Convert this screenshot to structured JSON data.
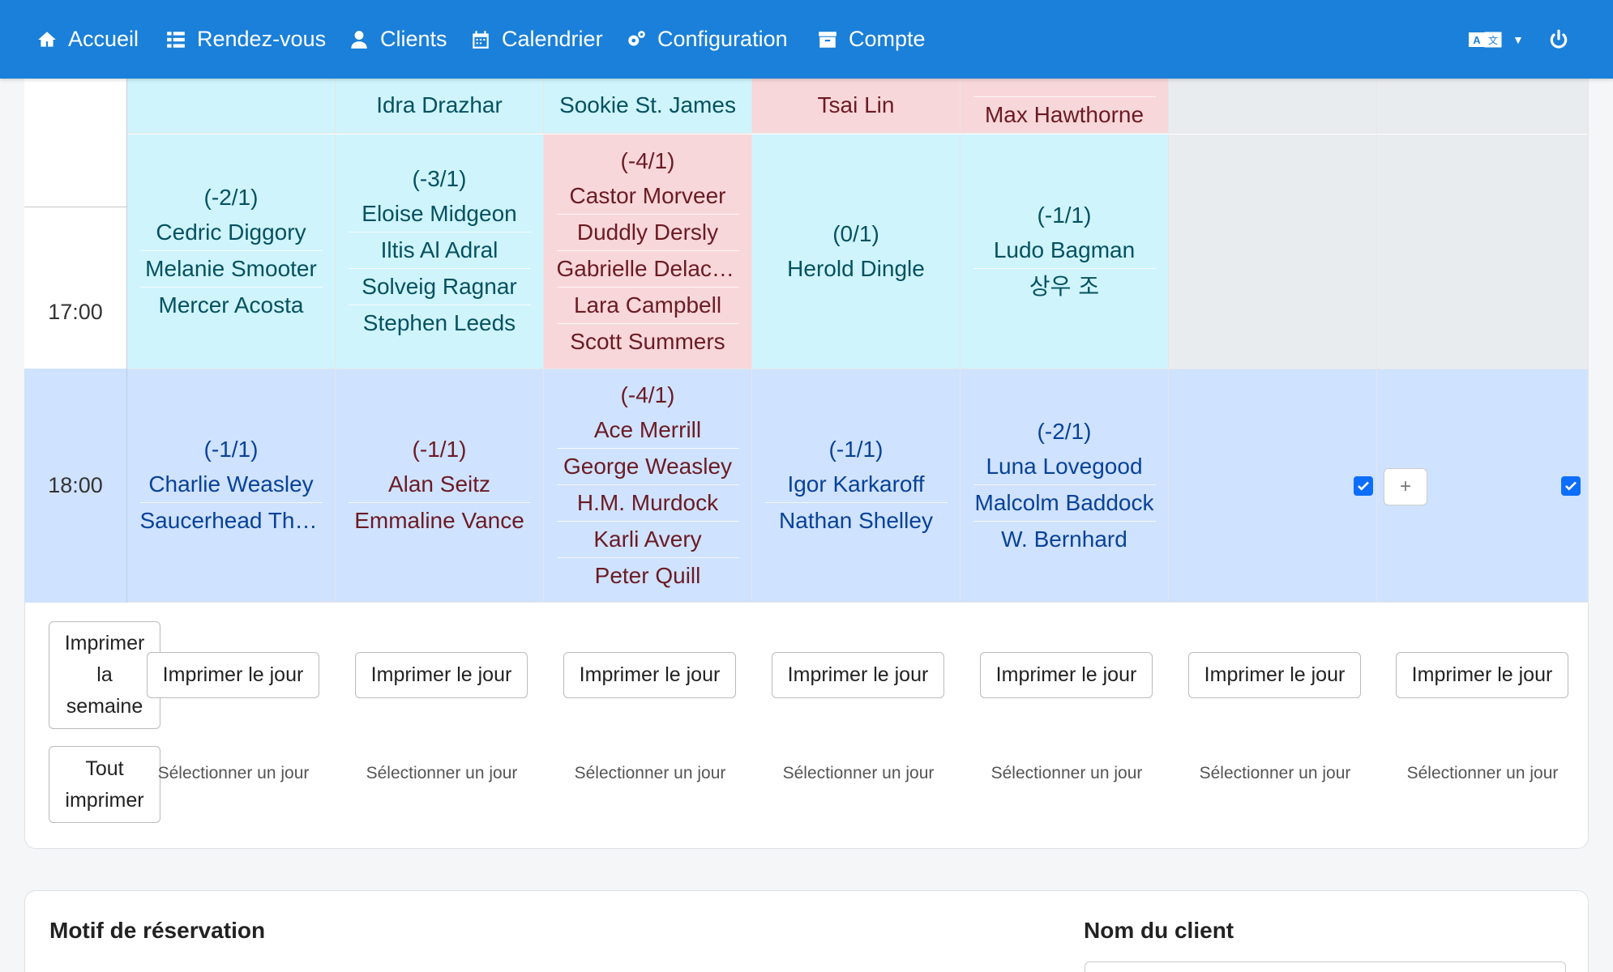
{
  "nav": {
    "items": [
      {
        "label": "Accueil",
        "icon": "home-icon"
      },
      {
        "label": "Rendez-vous",
        "icon": "list-icon"
      },
      {
        "label": "Clients",
        "icon": "user-icon"
      },
      {
        "label": "Calendrier",
        "icon": "calendar-icon"
      },
      {
        "label": "Configuration",
        "icon": "cogs-icon"
      },
      {
        "label": "Compte",
        "icon": "archive-icon"
      }
    ],
    "language_icon": "translate-icon",
    "power_icon": "power-icon"
  },
  "grid": {
    "times": [
      "17:00",
      "18:00"
    ],
    "row_top": [
      {
        "color": "cyan",
        "names": [
          ""
        ]
      },
      {
        "color": "cyan",
        "names": [
          "Idra Drazhar"
        ]
      },
      {
        "color": "cyan",
        "names": [
          "Sookie St. James"
        ]
      },
      {
        "color": "pink",
        "names": [
          "Tsai Lin"
        ]
      },
      {
        "color": "pink",
        "names": [
          "Max Hawthorne"
        ]
      },
      {
        "color": "grey",
        "names": []
      },
      {
        "color": "grey",
        "names": []
      }
    ],
    "row_17": [
      {
        "color": "cyan",
        "count": "(-2/1)",
        "names": [
          "Cedric Diggory",
          "Melanie Smooter",
          "Mercer Acosta"
        ]
      },
      {
        "color": "cyan",
        "count": "(-3/1)",
        "names": [
          "Eloise Midgeon",
          "Iltis Al Adral",
          "Solveig Ragnar",
          "Stephen Leeds"
        ]
      },
      {
        "color": "pink",
        "count": "(-4/1)",
        "names": [
          "Castor Morveer",
          "Duddly Dersly",
          "Gabrielle Delacour",
          "Lara Campbell",
          "Scott Summers"
        ]
      },
      {
        "color": "cyan",
        "count": "(0/1)",
        "names": [
          "Herold Dingle"
        ]
      },
      {
        "color": "cyan",
        "count": "(-1/1)",
        "names": [
          "Ludo Bagman",
          "상우 조"
        ]
      },
      {
        "color": "grey",
        "count": "",
        "names": []
      },
      {
        "color": "grey",
        "count": "",
        "names": []
      }
    ],
    "row_18": [
      {
        "color": "blue",
        "count": "(-1/1)",
        "names": [
          "Charlie Weasley",
          "Saucerhead Tharpe"
        ]
      },
      {
        "color": "blue",
        "count": "(-1/1)",
        "names": [
          "Alan Seitz",
          "Emmaline Vance"
        ]
      },
      {
        "color": "blue",
        "count": "(-4/1)",
        "names": [
          "Ace Merrill",
          "George Weasley",
          "H.M. Murdock",
          "Karli Avery",
          "Peter Quill"
        ]
      },
      {
        "color": "blue",
        "count": "(-1/1)",
        "names": [
          "Igor Karkaroff",
          "Nathan Shelley"
        ]
      },
      {
        "color": "blue",
        "count": "(-2/1)",
        "names": [
          "Luna Lovegood",
          "Malcolm Baddock",
          "W. Bernhard"
        ]
      },
      {
        "color": "blue",
        "count": "",
        "names": []
      },
      {
        "color": "blue",
        "count": "",
        "names": []
      }
    ],
    "add_label": "+"
  },
  "actions": {
    "print_week_l1": "Imprimer",
    "print_week_l2": "la",
    "print_week_l3": "semaine",
    "print_all_l1": "Tout",
    "print_all_l2": "imprimer",
    "print_day": "Imprimer le jour",
    "select_day": "Sélectionner un jour"
  },
  "form": {
    "reason_label": "Motif de réservation",
    "client_label": "Nom du client"
  }
}
